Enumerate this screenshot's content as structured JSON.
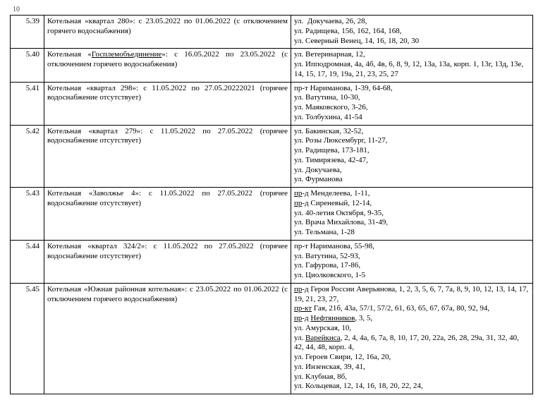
{
  "page_number": "10",
  "rows": [
    {
      "num": "5.39",
      "desc_html": "Котельная «квартал 280»: с 23.05.2022 по 01.06.2022 (с отключением горячего водоснабжения)",
      "addr_html": "ул.&nbsp; Докучаева, 26, 28,<br>ул. Радищева, 156, 162, 164, 168,<br>ул. Северный Венец, 14, 16, 18, 20, 30"
    },
    {
      "num": "5.40",
      "desc_html": "Котельная «<span class=\"u\">Госплемобъединение</span>»: с 16.05.2022 по 23.05.2022 (с отключением горячего водоснабжения)",
      "addr_html": "ул. Ветеринарная, 12,<br>ул. Ипподромная, 4а, 4б, 4в, 6, 8, 9, 12, 13а, 13а, корп. 1, 13г, 13д, 13е, 14, 15, 17, 19, 19а, 21, 23, 25, 27"
    },
    {
      "num": "5.41",
      "desc_html": "Котельная «квартал 298»: с 11.05.2022 по 27.05.20222021 (горячее водоснабжение отсутствует)",
      "addr_html": "пр-т Нариманова, 1-39, 64-68,<br>ул. Ватутина, 10-30,<br>ул. Маяковского, 3-26,<br>ул. Толбухина, 41-54"
    },
    {
      "num": "5.42",
      "desc_html": "Котельная «квартал 279»: с 11.05.2022 по 27.05.2022 (горячее водоснабжение отсутствует)",
      "addr_html": "ул. Бакинская, 32-52,<br>ул. Розы Люксембург, 11-27,<br>ул. Радищева, 173-181,<br>ул. Тимирязева, 42-47,<br>ул. Докучаева,<br>ул. Фурманова"
    },
    {
      "num": "5.43",
      "desc_html": "Котельная «Заволжье 4»: с 11.05.2022 по 27.05.2022 (горячее водоснабжение отсутствует)",
      "addr_html": "<span class=\"u\">пр</span>-д Менделеева, 1-11,<br><span class=\"u\">пр</span>-д Сиреневый, 12-14,<br>ул. 40-летия Октября, 9-35,<br>ул. Врача Михайлова, 31-49,<br>ул. Тельмана, 1-28"
    },
    {
      "num": "5.44",
      "desc_html": "Котельная «квартал 324/2»: с 11.05.2022 по 27.05.2022 (горячее водоснабжение отсутствует)",
      "addr_html": "пр-т Нариманова, 55-98,<br>ул. Ватутина, 52-93,<br>ул. Гафурова, 17-86,<br>ул. Циолковского, 1-5"
    },
    {
      "num": "5.45",
      "desc_html": "Котельная «Южная районная котельная»: с 23.05.2022 по 01.06.2022 (с отключением горячего водоснабжения)",
      "addr_html": "<span class=\"u\">пр</span>-д Героя России Аверьянова, 1, 2, 3, 5, 6, 7, 7а, 8, 9, 10, 12, 13, 14, 17, 19, 21, 23, 27,<br><span class=\"u\">пр-кт</span> Гая, 21б, 43а, 57/1, 57/2, 61, 63, 65, 67, 67а, 80, 92, 94,<br><span class=\"u\">пр</span>-д <span class=\"u\">Нефтянников</span>, 3, 5,<br>ул. Амурская, 10,<br>ул. <span class=\"u\">Варейкиса</span>, 2, 4, 4а, 6, 7а, 8, 10, 17, 20, 22а, 26, 28, 29а, 31, 32, 40, 42, 44, 48, корп. 4,<br>ул. Героев Свири, 12, 16а, 20,<br>ул. Инзенская, 39, 41,<br>ул. Клубная, 8б,<br>ул. Кольцевая, 12, 14, 16, 18, 20, 22, 24,"
    }
  ]
}
